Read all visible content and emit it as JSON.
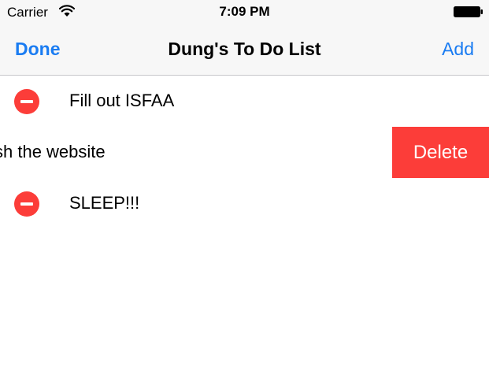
{
  "status_bar": {
    "carrier": "Carrier",
    "time": "7:09 PM",
    "icons": [
      "wifi-icon",
      "battery-icon"
    ]
  },
  "nav_bar": {
    "left_button": "Done",
    "title": "Dung's To Do List",
    "right_button": "Add"
  },
  "list": {
    "items": [
      {
        "label": "Fill out ISFAA",
        "state": "editing",
        "icon": "minus-circle-icon"
      },
      {
        "label": "sh the website",
        "state": "swiped-to-delete"
      },
      {
        "label": "SLEEP!!!",
        "state": "editing",
        "icon": "minus-circle-icon"
      }
    ],
    "delete_label": "Delete"
  },
  "colors": {
    "accent": "#1a7cf2",
    "destructive": "#fc3d39",
    "bar_background": "#f7f7f7",
    "separator": "#c8c7cc"
  }
}
